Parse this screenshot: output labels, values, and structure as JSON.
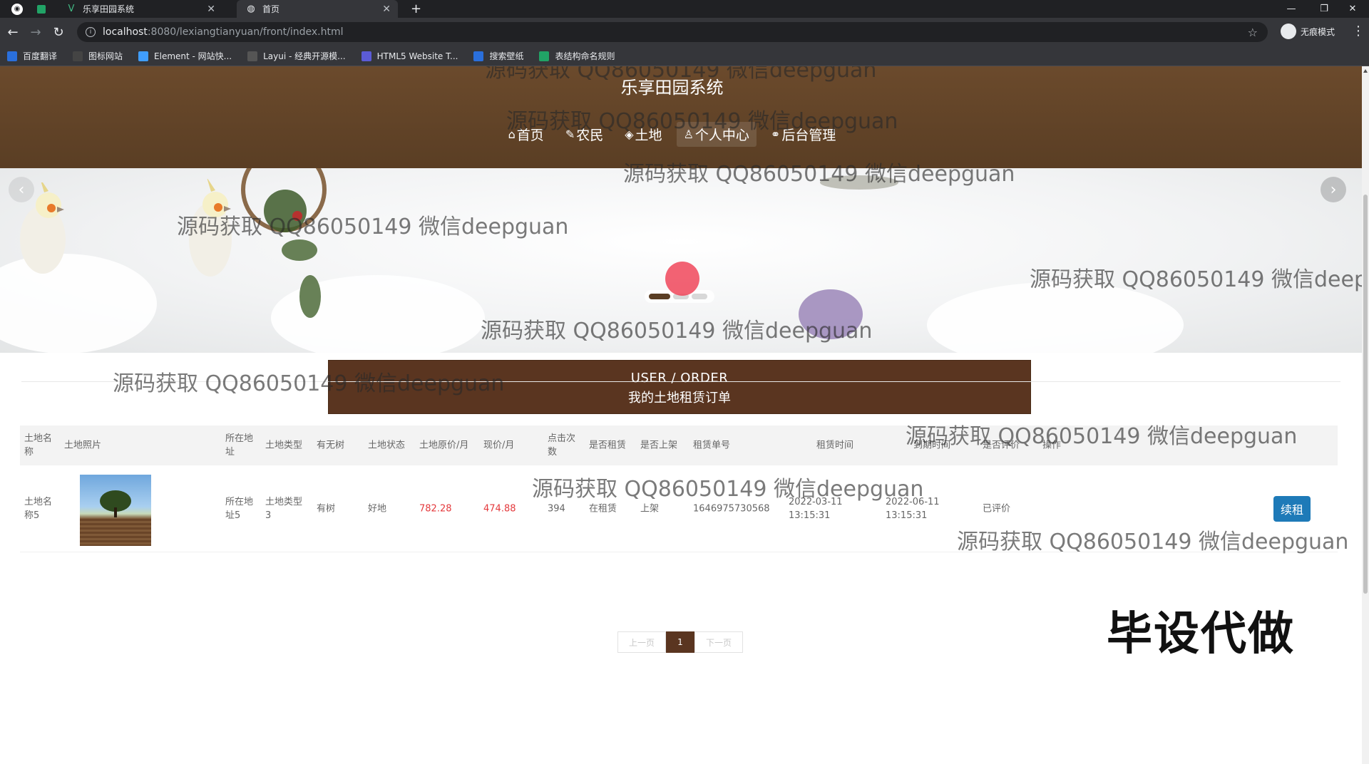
{
  "browser": {
    "tabs": [
      {
        "title": "乐享田园系统",
        "icon": "vue-icon"
      },
      {
        "title": "首页",
        "icon": "globe-icon"
      }
    ],
    "new_tab": "+",
    "url_host": "localhost",
    "url_path": ":8080/lexiangtianyuan/front/index.html",
    "incognito_label": "无痕模式",
    "bookmarks": [
      {
        "label": "百度翻译",
        "color": "#2a6fdb"
      },
      {
        "label": "图标网站",
        "color": "#444444"
      },
      {
        "label": "Element - 网站快...",
        "color": "#409eff"
      },
      {
        "label": "Layui - 经典开源模...",
        "color": "#555555"
      },
      {
        "label": "HTML5 Website T...",
        "color": "#5b5bd6"
      },
      {
        "label": "搜索壁纸",
        "color": "#2a6fdb"
      },
      {
        "label": "表结构命名规则",
        "color": "#21a366"
      }
    ]
  },
  "site": {
    "title": "乐享田园系统",
    "nav": [
      {
        "label": "首页",
        "icon": "home-icon",
        "glyph": "⌂"
      },
      {
        "label": "农民",
        "icon": "tag-icon",
        "glyph": "✎"
      },
      {
        "label": "土地",
        "icon": "layers-icon",
        "glyph": "◈"
      },
      {
        "label": "个人中心",
        "icon": "user-icon",
        "glyph": "♙"
      },
      {
        "label": "后台管理",
        "icon": "link-icon",
        "glyph": "⚭"
      }
    ],
    "active_nav": "个人中心",
    "accent": "#5a3520"
  },
  "banner": {
    "prev_arrow": "‹",
    "next_arrow": "›",
    "slide_count": 3,
    "active_slide": 1
  },
  "section": {
    "title_en": "USER / ORDER",
    "title_cn": "我的土地租赁订单"
  },
  "table": {
    "headers": [
      "土地名称",
      "土地照片",
      "所在地址",
      "土地类型",
      "有无树",
      "土地状态",
      "土地原价/月",
      "现价/月",
      "点击次数",
      "是否租赁",
      "是否上架",
      "租赁单号",
      "租赁时间",
      "到期时间",
      "是否评价",
      "操作"
    ],
    "rows": [
      {
        "name": "土地名称5",
        "address": "所在地址5",
        "type": "土地类型3",
        "has_tree": "有树",
        "status": "好地",
        "original_price": "782.28",
        "current_price": "474.88",
        "clicks": "394",
        "rented": "在租赁",
        "listed": "上架",
        "order_no": "1646975730568",
        "rent_time": "2022-03-11 13:15:31",
        "expire_time": "2022-06-11 13:15:31",
        "reviewed": "已评价",
        "action": "续租"
      }
    ]
  },
  "pagination": {
    "prev": "上一页",
    "page": "1",
    "next": "下一页"
  },
  "watermarks": {
    "text": "源码获取 QQ86050149 微信deepguan",
    "cut_text": "源码获取 QQ86050149 微信deepg",
    "big": "毕设代做"
  }
}
